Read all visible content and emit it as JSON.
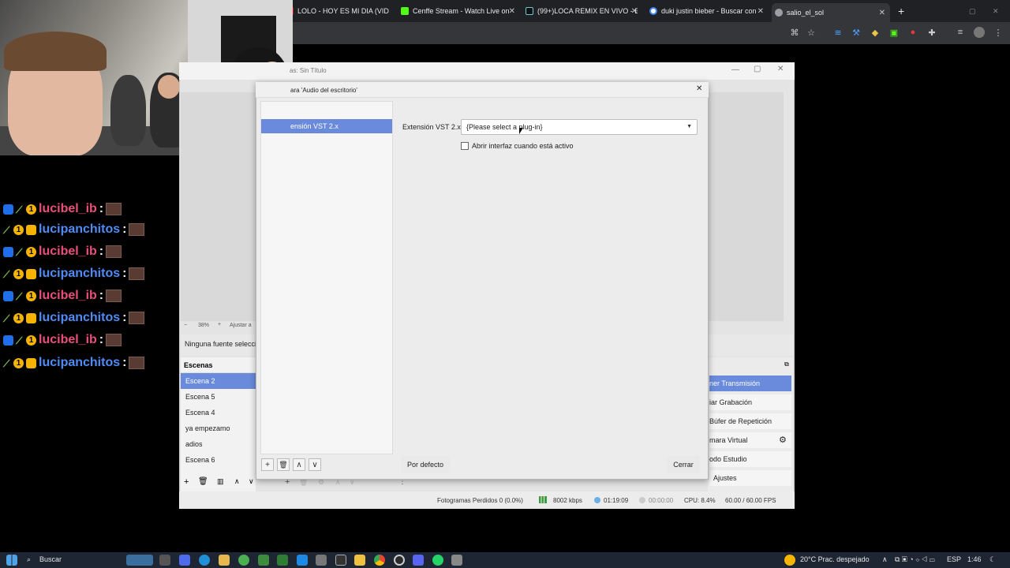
{
  "browser": {
    "tabs": [
      {
        "label": "LOLO - HOY ES MI DIA (VID",
        "icon": "youtube-icon",
        "color": "#ff0000"
      },
      {
        "label": "Cenffe Stream - Watch Live on",
        "icon": "kick-icon",
        "color": "#53fc18"
      },
      {
        "label": "(99+)LOCA REMIX EN VIVO - E",
        "icon": "tiktok-icon",
        "color": "#111111"
      },
      {
        "label": "duki justin bieber - Buscar con",
        "icon": "google-icon",
        "color": "#4285f4"
      },
      {
        "label": "salio_el_sol",
        "icon": "active-tab-icon",
        "color": "#9aa0a6"
      }
    ]
  },
  "chat": [
    {
      "user": "lucibel_ib",
      "color": "pink",
      "badges": [
        "wrench",
        "pepper",
        "coin"
      ]
    },
    {
      "user": "lucipanchitos",
      "color": "blue",
      "badges": [
        "pepper",
        "coin",
        "crown"
      ]
    },
    {
      "user": "lucibel_ib",
      "color": "pink",
      "badges": [
        "wrench",
        "pepper",
        "coin"
      ]
    },
    {
      "user": "lucipanchitos",
      "color": "blue",
      "badges": [
        "pepper",
        "coin",
        "crown"
      ]
    },
    {
      "user": "lucibel_ib",
      "color": "pink",
      "badges": [
        "wrench",
        "pepper",
        "coin"
      ]
    },
    {
      "user": "lucipanchitos",
      "color": "blue",
      "badges": [
        "pepper",
        "coin",
        "crown"
      ]
    },
    {
      "user": "lucibel_ib",
      "color": "pink",
      "badges": [
        "wrench",
        "pepper",
        "coin"
      ]
    },
    {
      "user": "lucipanchitos",
      "color": "blue",
      "badges": [
        "pepper",
        "coin",
        "crown"
      ]
    }
  ],
  "chat_separator": " :",
  "obs": {
    "title": "as: Sin Título",
    "zoom": "38%",
    "zoom_fit": "Ajustar a",
    "no_source": "Ninguna fuente selecci",
    "scenes_header": "Escenas",
    "scenes": [
      "Escena 2",
      "Escena 5",
      "Escena 4",
      "ya empezamo",
      "adios",
      "Escena 6"
    ],
    "selected_scene": "Escena 2",
    "controls": [
      "ner Transmisión",
      "iar Grabación",
      "Búfer de Repetición",
      "mara Virtual",
      "odo Estudio",
      "Ajustes"
    ],
    "status": {
      "dropped": "Fotogramas Perdidos 0 (0.0%)",
      "bitrate": "8002 kbps",
      "stream_time": "01:19:09",
      "rec_time": "00:00:00",
      "cpu": "CPU: 8.4%",
      "fps": "60.00 / 60.00 FPS"
    }
  },
  "dialog": {
    "title": "ara 'Audio del escritorio'",
    "section": "audio",
    "filter_selected": "ensión VST 2.x",
    "plugin_label": "Extensión VST 2.x",
    "plugin_value": "{Please select a plug-in}",
    "checkbox_label": "Abrir interfaz cuando está activo",
    "default_button": "Por defecto",
    "close_button": "Cerrar"
  },
  "taskbar": {
    "search": "Buscar",
    "weather": "20°C  Prac. despejado",
    "lang": "ESP",
    "time": "1:46"
  }
}
